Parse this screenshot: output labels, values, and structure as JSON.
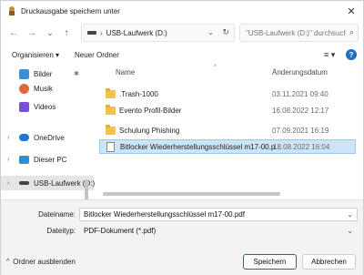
{
  "window": {
    "title": "Druckausgabe speichern unter",
    "close_glyph": "✕"
  },
  "address": {
    "path_label": "USB-Laufwerk (D:)",
    "search_placeholder": "\"USB-Laufwerk (D:)\" durchsuchen"
  },
  "toolbar": {
    "organize_label": "Organisieren ▾",
    "new_folder_label": "Neuer Ordner"
  },
  "nav": {
    "items": [
      {
        "label": "Bilder",
        "icon": "pictures-icon",
        "pinned": true
      },
      {
        "label": "Musik",
        "icon": "music-icon"
      },
      {
        "label": "Videos",
        "icon": "videos-icon"
      },
      {
        "label": "OneDrive",
        "icon": "onedrive-icon"
      },
      {
        "label": "Dieser PC",
        "icon": "pc-icon"
      },
      {
        "label": "USB-Laufwerk (D:)",
        "icon": "usb-drive-icon",
        "selected": true
      }
    ]
  },
  "list": {
    "col_name": "Name",
    "col_date": "Änderungsdatum",
    "rows": [
      {
        "name": ".Trash-1000",
        "date": "03.11.2021 09:40",
        "type": "folder"
      },
      {
        "name": "Evento Profil-Bilder",
        "date": "16.08.2022 12:17",
        "type": "folder"
      },
      {
        "name": "Schulung Phishing",
        "date": "07.09.2021 16:19",
        "type": "folder"
      },
      {
        "name": "Bitlocker Wiederherstellungsschlüssel m17-00.p...",
        "date": "18.08.2022 16:04",
        "type": "document",
        "selected": true
      }
    ]
  },
  "form": {
    "filename_label": "Dateiname:",
    "filename_value": "Bitlocker Wiederherstellungsschlüssel m17-00.pdf",
    "filetype_label": "Dateityp:",
    "filetype_value": "PDF-Dokument (*.pdf)"
  },
  "footer": {
    "hide_folders_label": "Ordner ausblenden",
    "save_label": "Speichern",
    "cancel_label": "Abbrechen"
  },
  "colors": {
    "accent": "#0f6cbd",
    "selection": "#cce4f7",
    "folder": "#f3c24b"
  }
}
